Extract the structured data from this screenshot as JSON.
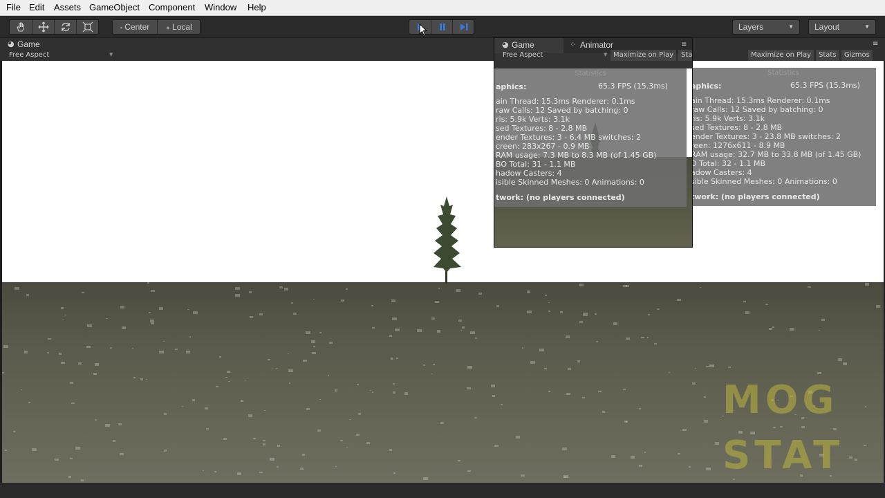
{
  "menu": [
    "File",
    "Edit",
    "Assets",
    "GameObject",
    "Component",
    "Window",
    "Help"
  ],
  "toolbar": {
    "pivot_label": "Center",
    "space_label": "Local",
    "layers_label": "Layers",
    "layout_label": "Layout"
  },
  "game_panel": {
    "tab_label": "Game",
    "aspect_label": "Free Aspect",
    "maximize_label": "Maximize on Play",
    "stats_label": "Stats",
    "gizmos_label": "Gizmos"
  },
  "float_panel": {
    "tab_game": "Game",
    "tab_animator": "Animator",
    "aspect_label": "Free Aspect",
    "maximize_label": "Maximize on Play",
    "stats_label": "Sta"
  },
  "stats_small": {
    "title": "Statistics",
    "graphics": "aphics:",
    "fps": "65.3 FPS (15.3ms)",
    "lines": [
      "ain Thread: 15.3ms  Renderer: 0.1ms",
      "raw Calls: 12     Saved by batching: 0",
      "ris: 5.9k     Verts: 3.1k",
      "sed Textures: 8 - 2.8 MB",
      "ender Textures: 3 - 6.4 MB  switches: 2",
      "creen: 283x267 - 0.9 MB",
      "RAM usage: 7.3 MB to 8.3 MB (of 1.45 GB)",
      "BO Total: 31 - 1.1 MB",
      "hadow Casters: 4",
      "isible Skinned Meshes: 0     Animations: 0"
    ],
    "network": "twork: (no players connected)"
  },
  "stats_big": {
    "title": "Statistics",
    "graphics": "aphics:",
    "fps": "65.3 FPS (15.3ms)",
    "lines": [
      "ain Thread: 15.3ms  Renderer: 0.1ms",
      "raw Calls: 12     Saved by batching: 0",
      "ris: 5.9k     Verts: 3.1k",
      "sed Textures: 8 - 2.8 MB",
      "ender Textures: 3 - 23.8 MB    switches: 2",
      "reen: 1276x611 - 8.9 MB",
      "RAM usage: 32.7 MB to 33.8 MB (of 1.45 GB)",
      "O Total: 32 - 1.1 MB",
      "adow Casters: 4",
      "sible Skinned Meshes: 0     Animations: 0"
    ],
    "network": "twork: (no players connected)"
  },
  "watermark": {
    "line1": "MOG",
    "line2": "STAT"
  },
  "colors": {
    "play_blue": "#3a78d8",
    "watermark": "#bdb43c"
  }
}
